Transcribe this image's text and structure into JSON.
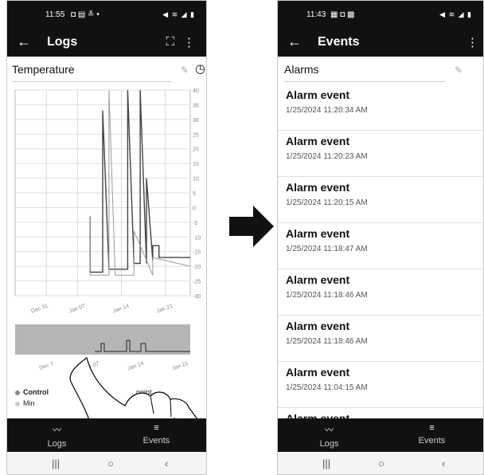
{
  "left": {
    "status_time": "11:55",
    "status_icons": "◘ ▤ ≚ •",
    "status_right": "◀ ≋ ◢ ▮",
    "title": "Logs",
    "expand_glyph": "⛶",
    "menu_glyph": "⋮",
    "section_label": "Temperature",
    "y_ticks": [
      "40",
      "35",
      "30",
      "25",
      "20",
      "15",
      "10",
      "5",
      "0",
      "-5",
      "-10",
      "-15",
      "-20",
      "-25",
      "-30"
    ],
    "x_ticks": [
      "Dec 31",
      "Jan 07",
      "Jan 14",
      "Jan 21"
    ],
    "overview_x_ticks": [
      "Dec 7",
      "Jan 07",
      "Jan 14",
      "Jan 21"
    ],
    "legend": [
      {
        "label": "Control",
        "color": "#888888",
        "bold": true
      },
      {
        "label": "Min",
        "color": "#cccccc",
        "bold": false
      }
    ],
    "legend_partial": "point",
    "nav": [
      {
        "label": "Logs",
        "icon": "chart-line-icon"
      },
      {
        "label": "Events",
        "icon": "list-icon"
      }
    ]
  },
  "right": {
    "status_time": "11:43",
    "status_icons": "▦ ◘ ▩",
    "status_right": "◀ ≋ ◢ ▮",
    "title": "Events",
    "menu_glyph": "⋮",
    "section_label": "Alarms",
    "events": [
      {
        "title": "Alarm event",
        "date": "1/25/2024 11:20:34 AM"
      },
      {
        "title": "Alarm event",
        "date": "1/25/2024 11:20:23 AM"
      },
      {
        "title": "Alarm event",
        "date": "1/25/2024 11:20:15 AM"
      },
      {
        "title": "Alarm event",
        "date": "1/25/2024 11:18:47 AM"
      },
      {
        "title": "Alarm event",
        "date": "1/25/2024 11:18:46 AM"
      },
      {
        "title": "Alarm event",
        "date": "1/25/2024 11:18:46 AM"
      },
      {
        "title": "Alarm event",
        "date": "1/25/2024 11:04:15 AM"
      },
      {
        "title": "Alarm event",
        "date": ""
      }
    ],
    "nav": [
      {
        "label": "Logs",
        "icon": "chart-line-icon"
      },
      {
        "label": "Events",
        "icon": "list-icon"
      }
    ]
  },
  "chart_data": {
    "type": "line",
    "title": "Temperature",
    "ylim": [
      -30,
      40
    ],
    "x_ticks": [
      "Dec 31",
      "Jan 07",
      "Jan 14",
      "Jan 21"
    ],
    "series": [
      {
        "x": [
          "2024-01-09",
          "2024-01-09",
          "2024-01-10",
          "2024-01-11",
          "2024-01-11",
          "2024-01-12",
          "2024-01-13",
          "2024-01-14",
          "2024-01-15",
          "2024-01-15",
          "2024-01-16",
          "2024-01-17",
          "2024-01-17",
          "2024-01-18",
          "2024-01-18",
          "2024-01-19",
          "2024-01-19",
          "2024-01-20",
          "2024-01-20",
          "2024-01-25"
        ],
        "y": [
          -3,
          -22,
          -22,
          -22,
          33,
          -21,
          -21,
          -21,
          -21,
          40,
          -19,
          -19,
          40,
          -19,
          10,
          -18,
          -13,
          -13,
          -17,
          -17
        ]
      },
      {
        "x": [
          "2024-01-09",
          "2024-01-09",
          "2024-01-12",
          "2024-01-12",
          "2024-01-13",
          "2024-01-16",
          "2024-01-16",
          "2024-01-19",
          "2024-01-19",
          "2024-01-25"
        ],
        "y": [
          -3,
          -23,
          -23,
          40,
          -23,
          -23,
          -8,
          -23,
          -17,
          -20
        ]
      }
    ]
  }
}
